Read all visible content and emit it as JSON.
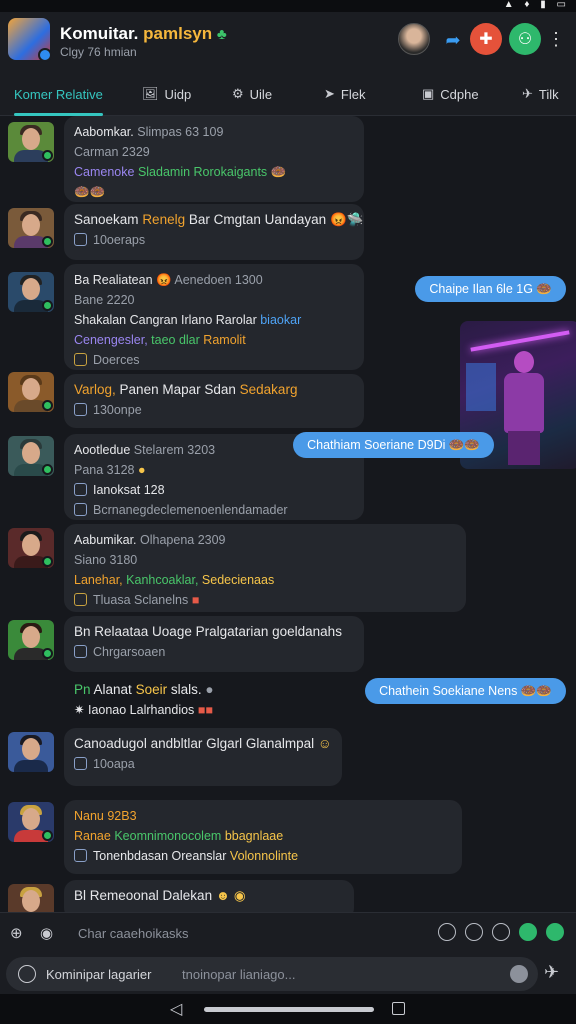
{
  "header": {
    "title_main": "Komuitar.",
    "title_accent": "pamlsyn",
    "title_emoji": "♣",
    "subtitle": "Clgy 76 hmian",
    "icons": [
      "app-avatar",
      "user-avatar",
      "share-icon",
      "red-action-icon",
      "green-action-icon",
      "more-vert-icon"
    ]
  },
  "tabs": [
    {
      "label": "Komer Relative",
      "icon": ""
    },
    {
      "label": "Uidp",
      "icon": "🖼"
    },
    {
      "label": "Uile",
      "icon": "⚙"
    },
    {
      "label": "Flek",
      "icon": "➤"
    },
    {
      "label": "Cdphe",
      "icon": "▣"
    },
    {
      "label": "Tilk",
      "icon": "✈"
    }
  ],
  "messages": [
    {
      "l1_name": "Aabomkar.",
      "l1_meta": "Slimpas 63 109",
      "l2": "Carman 2329",
      "l3_a": "Camenoke",
      "l3_b": "Sladamin Rorokaigants",
      "l3_emoji": "🍩",
      "l4": "🍩🍩"
    },
    {
      "l1": "Sanoekam",
      "l1_accent": "Renelg",
      "l1_rest": "Bar Cmgtan Uandayan",
      "l1_emoji": "😡🛸",
      "l2": "10oeraps"
    },
    {
      "l1": "Ba Realiatean",
      "l1_emoji": "😡",
      "l1_meta": "Aenedoen 1300",
      "l2": "Bane 2220",
      "l3": "Shakalan Cangran Irlano Rarolar",
      "l3_accent": "biaokar",
      "l4_a": "Cenengesler,",
      "l4_b": "taeo dlar",
      "l4_c": "Ramolit",
      "l5": "Doerces"
    },
    {
      "l1_a": "Varlog,",
      "l1_b": "Panen Mapar Sdan",
      "l1_c": "Sedakarg",
      "l2": "130onpe"
    },
    {
      "l1_name": "Aootledue",
      "l1_meta": "Stelarem 3203",
      "l2": "Pana 3128",
      "l3": "Ianoksat 128",
      "l4": "Bcrnanegdeclemenoenlendamader"
    },
    {
      "l1_name": "Aabumikar.",
      "l1_meta": "Olhapena 2309",
      "l2": "Siano 3180",
      "l3_a": "Lanehar,",
      "l3_b": "Kanhcoaklar,",
      "l3_c": "Sedecienaas",
      "l4": "Tluasa Sclanelns"
    },
    {
      "l1": "Bn Relaataa Uoage Pralgatarian goeldanahs",
      "l2": "Chrgarsoaen"
    },
    {
      "l1_a": "Pn",
      "l1_b": "Alanat",
      "l1_c": "Soeir",
      "l1_d": "slals.",
      "l2": "Iaonao Lalrhandios"
    },
    {
      "l1": "Canoadugol andbltlar Glgarl Glanalmpal",
      "l2": "10oapa"
    },
    {
      "l1": "Nanu 92B3",
      "l2_a": "Ranae",
      "l2_b": "Keomnimonocolem",
      "l2_c": "bbagnlaae",
      "l3": "Tonenbdasan Oreanslar",
      "l3_accent": "Volonnolinte"
    },
    {
      "l1": "Bl Remeoonal Dalekan",
      "l2": ""
    }
  ],
  "outgoing": [
    {
      "text": "Chaipe Ilan 6le 1G",
      "emoji": "🍩"
    },
    {
      "text": "Chathiam Soeriane D9Di",
      "emoji": "🍩🍩"
    },
    {
      "text": "Chathein Soekiane Nens",
      "emoji": "🍩🍩"
    }
  ],
  "composer": {
    "placeholder": "Char caaehoikasks"
  },
  "input": {
    "label": "Kominipar lagarier",
    "placeholder": "tnoinopar lianiago..."
  },
  "colors": {
    "accent": "#35c6c0",
    "outgoing": "#4a9ae8",
    "background": "#16181d",
    "bubble": "#24272d"
  }
}
